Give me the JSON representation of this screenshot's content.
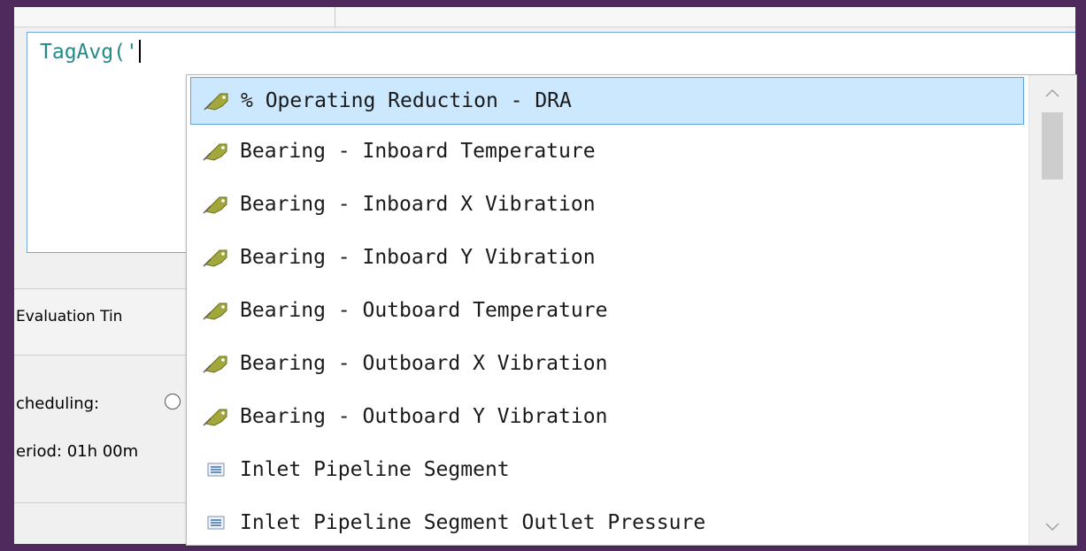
{
  "editor": {
    "text": "TagAvg('"
  },
  "background": {
    "tab_label": "Evaluation Tin",
    "scheduling_label": "cheduling:",
    "period_label": "eriod: 01h 00m"
  },
  "autocomplete": {
    "items": [
      {
        "label": "% Operating Reduction - DRA",
        "icon": "tag-icon",
        "selected": true
      },
      {
        "label": "Bearing - Inboard Temperature",
        "icon": "tag-icon"
      },
      {
        "label": "Bearing - Inboard X Vibration",
        "icon": "tag-icon"
      },
      {
        "label": "Bearing - Inboard Y Vibration",
        "icon": "tag-icon"
      },
      {
        "label": "Bearing - Outboard Temperature",
        "icon": "tag-icon"
      },
      {
        "label": "Bearing - Outboard X Vibration",
        "icon": "tag-icon"
      },
      {
        "label": "Bearing - Outboard Y Vibration",
        "icon": "tag-icon"
      },
      {
        "label": "Inlet Pipeline Segment",
        "icon": "element-icon"
      },
      {
        "label": "Inlet Pipeline Segment Outlet Pressure",
        "icon": "element-icon"
      }
    ]
  },
  "colors": {
    "frame": "#4f2a5c",
    "selection": "#cce8ff",
    "selection_border": "#5ba4dc",
    "code_text": "#238a8a",
    "tag_icon": "#a3a83c"
  }
}
